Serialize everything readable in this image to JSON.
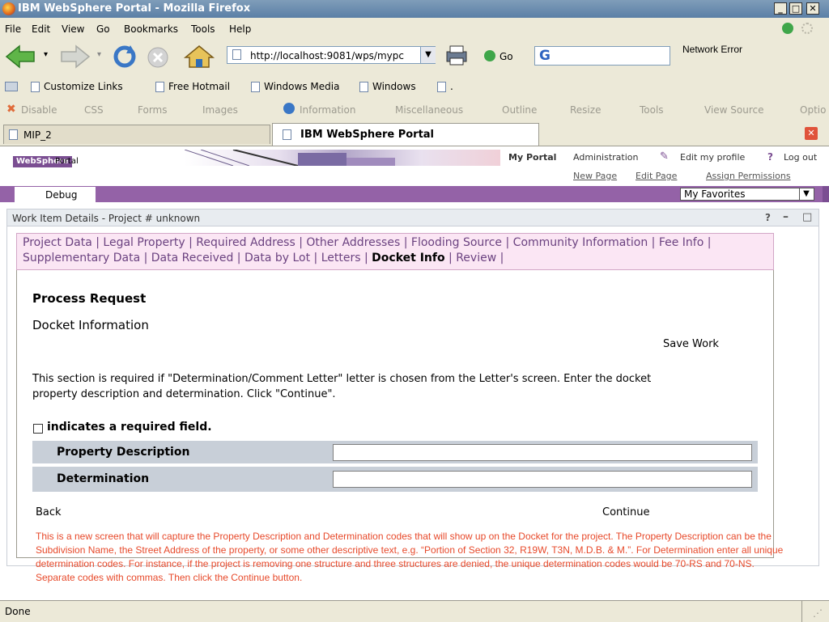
{
  "window": {
    "title": "IBM WebSphere Portal - Mozilla Firefox"
  },
  "menu": [
    "File",
    "Edit",
    "View",
    "Go",
    "Bookmarks",
    "Tools",
    "Help"
  ],
  "nav": {
    "url": "http://localhost:9081/wps/mypc",
    "go_label": "Go",
    "search_brand": "G",
    "network_error": "Network Error"
  },
  "bookmarks": [
    "Customize Links",
    "Free Hotmail",
    "Windows Media",
    "Windows",
    "."
  ],
  "devbar": [
    "Disable",
    "CSS",
    "Forms",
    "Images",
    "Information",
    "Miscellaneous",
    "Outline",
    "Resize",
    "Tools",
    "View Source",
    "Optio"
  ],
  "tabs": [
    {
      "label": "MIP_2"
    },
    {
      "label": "IBM WebSphere Portal"
    }
  ],
  "portal": {
    "logo_primary": "WebSphere",
    "logo_secondary": "Portal",
    "top_links": [
      "My Portal",
      "Administration",
      "Edit my profile",
      "Log out"
    ],
    "help_glyph": "?",
    "sub_links": [
      "New Page",
      "Edit Page",
      "Assign Permissions"
    ],
    "page_tab": "Debug",
    "favorites": "My Favorites"
  },
  "portlet": {
    "title": "Work Item Details - Project # unknown",
    "controls": [
      "?",
      "–",
      "□"
    ],
    "nav_links": [
      "Project Data",
      "Legal Property",
      "Required Address",
      "Other Addresses",
      "Flooding Source",
      "Community Information",
      "Fee Info",
      "Supplementary Data",
      "Data Received",
      "Data by Lot",
      "Letters",
      "Docket Info",
      "Review"
    ],
    "active_link": "Docket Info",
    "heading": "Process Request",
    "subheading": "Docket Information",
    "save_work": "Save Work",
    "instructions_line1": "This section is required if \"Determination/Comment Letter\" letter is chosen from the Letter's screen. Enter the docket",
    "instructions_line2": "property description and determination. Click \"Continue\".",
    "required_note": "indicates a required field.",
    "fields": [
      {
        "label": "Property Description",
        "value": ""
      },
      {
        "label": "Determination",
        "value": ""
      }
    ],
    "back": "Back",
    "continue": "Continue"
  },
  "annotation": "This is a new screen that will capture the Property Description and Determination codes that will show up on the Docket for the project. The Property Description can be the Subdivision Name, the Street Address of the property, or some other descriptive text, e.g. “Portion of Section 32, R19W, T3N, M.D.B. & M.”. For Determination enter all unique determination codes. For instance, if the project is removing one structure and three structures are denied, the unique determination codes would be 70-RS and 70-NS. Separate codes with commas. Then click the Continue button.",
  "status": "Done",
  "colors": {
    "portal_purple": "#9462a7",
    "note_red": "#e7492a",
    "nav_pink": "#fbe6f4"
  }
}
